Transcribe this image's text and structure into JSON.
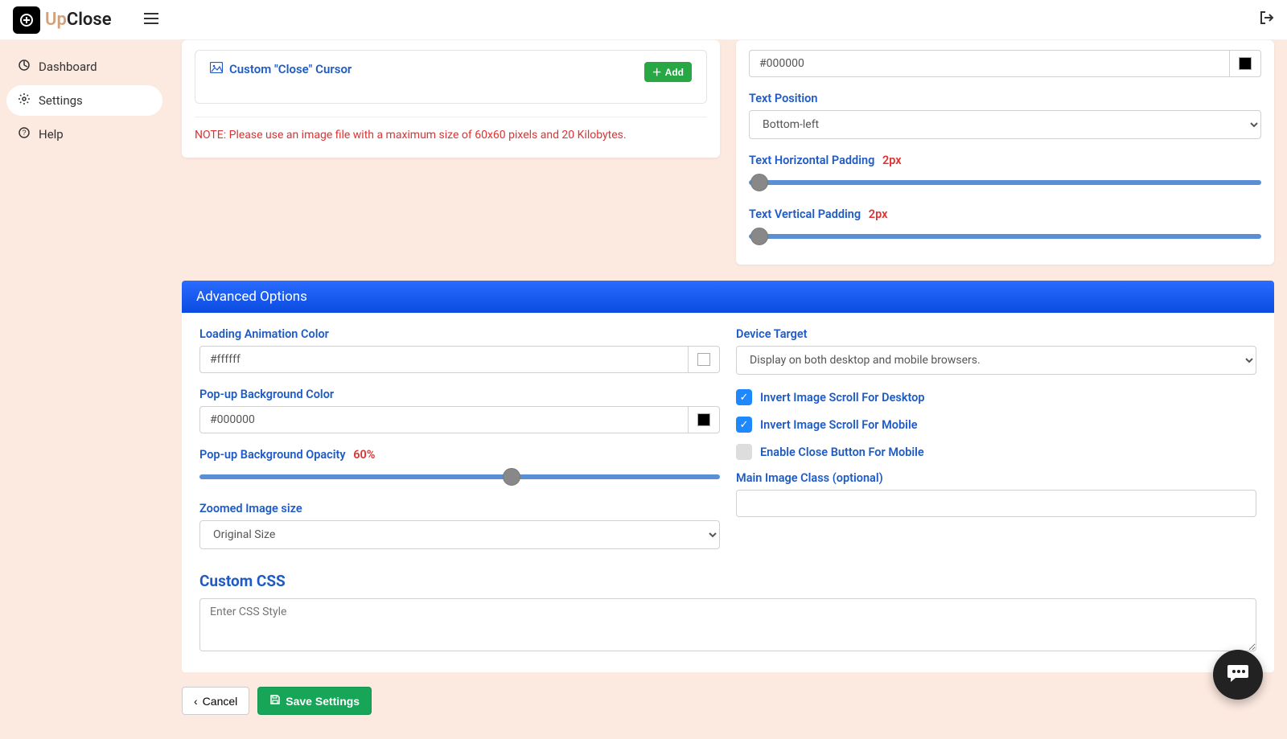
{
  "brand": {
    "up": "Up",
    "close": "Close"
  },
  "sidebar": {
    "items": [
      {
        "label": "Dashboard"
      },
      {
        "label": "Settings"
      },
      {
        "label": "Help"
      }
    ]
  },
  "cursor_panel": {
    "title": "Custom \"Close\" Cursor",
    "add_label": "Add",
    "note": "NOTE: Please use an image file with a maximum size of 60x60 pixels and 20 Kilobytes."
  },
  "right_panel": {
    "text_color_value": "#000000",
    "text_position_label": "Text Position",
    "text_position_value": "Bottom-left",
    "h_pad_label": "Text Horizontal Padding",
    "h_pad_value": "2",
    "h_pad_unit": "px",
    "v_pad_label": "Text Vertical Padding",
    "v_pad_value": "2",
    "v_pad_unit": "px"
  },
  "advanced": {
    "header": "Advanced Options",
    "loading_color_label": "Loading Animation Color",
    "loading_color_value": "#ffffff",
    "popup_bg_label": "Pop-up Background Color",
    "popup_bg_value": "#000000",
    "popup_opacity_label": "Pop-up Background Opacity",
    "popup_opacity_value": "60",
    "popup_opacity_unit": "%",
    "zoom_size_label": "Zoomed Image size",
    "zoom_size_value": "Original Size",
    "device_target_label": "Device Target",
    "device_target_value": "Display on both desktop and mobile browsers.",
    "invert_desktop_label": "Invert Image Scroll For Desktop",
    "invert_mobile_label": "Invert Image Scroll For Mobile",
    "enable_close_mobile_label": "Enable Close Button For Mobile",
    "main_image_class_label": "Main Image Class (optional)",
    "main_image_class_value": "",
    "custom_css_title": "Custom CSS",
    "custom_css_placeholder": "Enter CSS Style"
  },
  "footer": {
    "cancel": "Cancel",
    "save": "Save Settings"
  }
}
